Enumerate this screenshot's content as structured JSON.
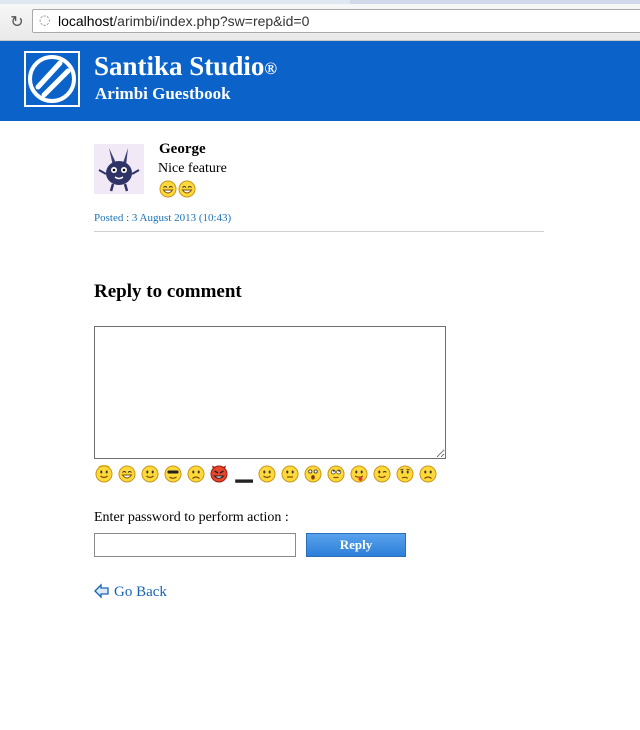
{
  "browser": {
    "url_host": "localhost",
    "url_path": "/arimbi/index.php?sw=rep&id=0",
    "reload_icon": "reload-icon",
    "site_icon": "globe-icon"
  },
  "header": {
    "title": "Santika Studio",
    "trademark": "®",
    "subtitle": "Arimbi Guestbook",
    "bg_color": "#0b63c9"
  },
  "comment": {
    "author": "George",
    "text": "Nice feature",
    "smileys": [
      "grin",
      "grin"
    ],
    "posted": "Posted : 3 August 2013 (10:43)"
  },
  "reply": {
    "heading": "Reply to comment",
    "textarea_value": "",
    "emoticons": [
      "angel",
      "grin",
      "smile",
      "cool",
      "sad",
      "devil",
      "blank",
      "smile",
      "neutral",
      "surprised",
      "rolleyes",
      "tongue",
      "wink",
      "worried",
      "frown"
    ],
    "password_label": "Enter password to perform action :",
    "password_value": "",
    "button_label": "Reply"
  },
  "nav": {
    "back_label": "Go Back",
    "link_color": "#1a63b6"
  }
}
